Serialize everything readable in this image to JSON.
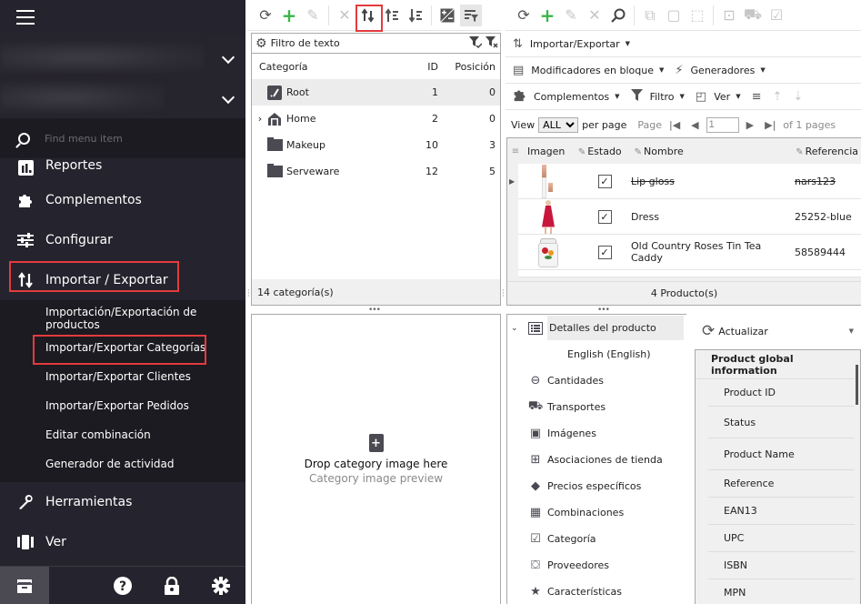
{
  "sidebar": {
    "search_placeholder": "Find menu item",
    "items": [
      {
        "label": "Reportes",
        "icon": "bar-chart-icon"
      },
      {
        "label": "Complementos",
        "icon": "puzzle-icon"
      },
      {
        "label": "Configurar",
        "icon": "sliders-icon"
      },
      {
        "label": "Importar / Exportar",
        "icon": "import-export-icon"
      }
    ],
    "subitems": [
      "Importación/Exportación de productos",
      "Importar/Exportar Categorías",
      "Importar/Exportar Clientes",
      "Importar/Exportar Pedidos",
      "Editar combinación",
      "Generador de actividad"
    ],
    "items_after": [
      {
        "label": "Herramientas",
        "icon": "wrench-icon"
      },
      {
        "label": "Ver",
        "icon": "columns-icon"
      }
    ],
    "bottom": {
      "help": "?",
      "lock": "lock-icon",
      "settings": "gear-icon"
    }
  },
  "categories": {
    "filter_placeholder": "Filtro de texto",
    "columns": [
      "Categoría",
      "ID",
      "Posición"
    ],
    "rows": [
      {
        "name": "Root",
        "id": "1",
        "position": "0",
        "icon": "root-icon",
        "expandable": false
      },
      {
        "name": "Home",
        "id": "2",
        "position": "0",
        "icon": "home-icon",
        "expandable": true
      },
      {
        "name": "Makeup",
        "id": "10",
        "position": "3",
        "icon": "folder-icon",
        "expandable": false
      },
      {
        "name": "Serveware",
        "id": "12",
        "position": "5",
        "icon": "folder-icon",
        "expandable": false
      }
    ],
    "footer": "14 categoría(s)",
    "drop_title": "Drop category image here",
    "drop_subtitle": "Category image preview"
  },
  "products": {
    "import_export": "Importar/Exportar",
    "bulk_modifiers": "Modificadores en bloque",
    "generators": "Generadores",
    "addons": "Complementos",
    "filter": "Filtro",
    "view": "Ver",
    "pager": {
      "view_label": "View",
      "per_page_value": "ALL",
      "per_page_label": "per page",
      "page_label": "Page",
      "page_value": "1",
      "of_pages": "of 1 pages"
    },
    "columns": [
      "Imagen",
      "Estado",
      "Nombre",
      "Referencia"
    ],
    "rows": [
      {
        "image": "lip-gloss",
        "active": true,
        "name": "Lip gloss",
        "reference": "nars123",
        "strikethrough": true
      },
      {
        "image": "dress",
        "active": true,
        "name": "Dress",
        "reference": "25252-blue",
        "strikethrough": false
      },
      {
        "image": "tea-caddy",
        "active": true,
        "name": "Old Country Roses Tin Tea Caddy",
        "reference": "58589444",
        "strikethrough": false
      }
    ],
    "footer": "4 Producto(s)"
  },
  "details": {
    "header": "Detalles del producto",
    "language": "English (English)",
    "items": [
      {
        "label": "Cantidades",
        "icon": "quantities-icon"
      },
      {
        "label": "Transportes",
        "icon": "truck-icon"
      },
      {
        "label": "Imágenes",
        "icon": "image-icon"
      },
      {
        "label": "Asociaciones de tienda",
        "icon": "store-association-icon"
      },
      {
        "label": "Precios específicos",
        "icon": "tag-icon"
      },
      {
        "label": "Combinaciones",
        "icon": "combinations-icon"
      },
      {
        "label": "Categoría",
        "icon": "category-icon"
      },
      {
        "label": "Proveedores",
        "icon": "supplier-icon"
      },
      {
        "label": "Características",
        "icon": "star-icon"
      }
    ]
  },
  "info": {
    "refresh_label": "Actualizar",
    "title": "Product global information",
    "fields": [
      "Product ID",
      "Status",
      "Product Name",
      "Reference",
      "EAN13",
      "UPC",
      "ISBN",
      "MPN"
    ]
  },
  "colors": {
    "sidebar_bg": "#25232d",
    "highlight_red": "#e33b3e",
    "add_green": "#3ab54a"
  }
}
